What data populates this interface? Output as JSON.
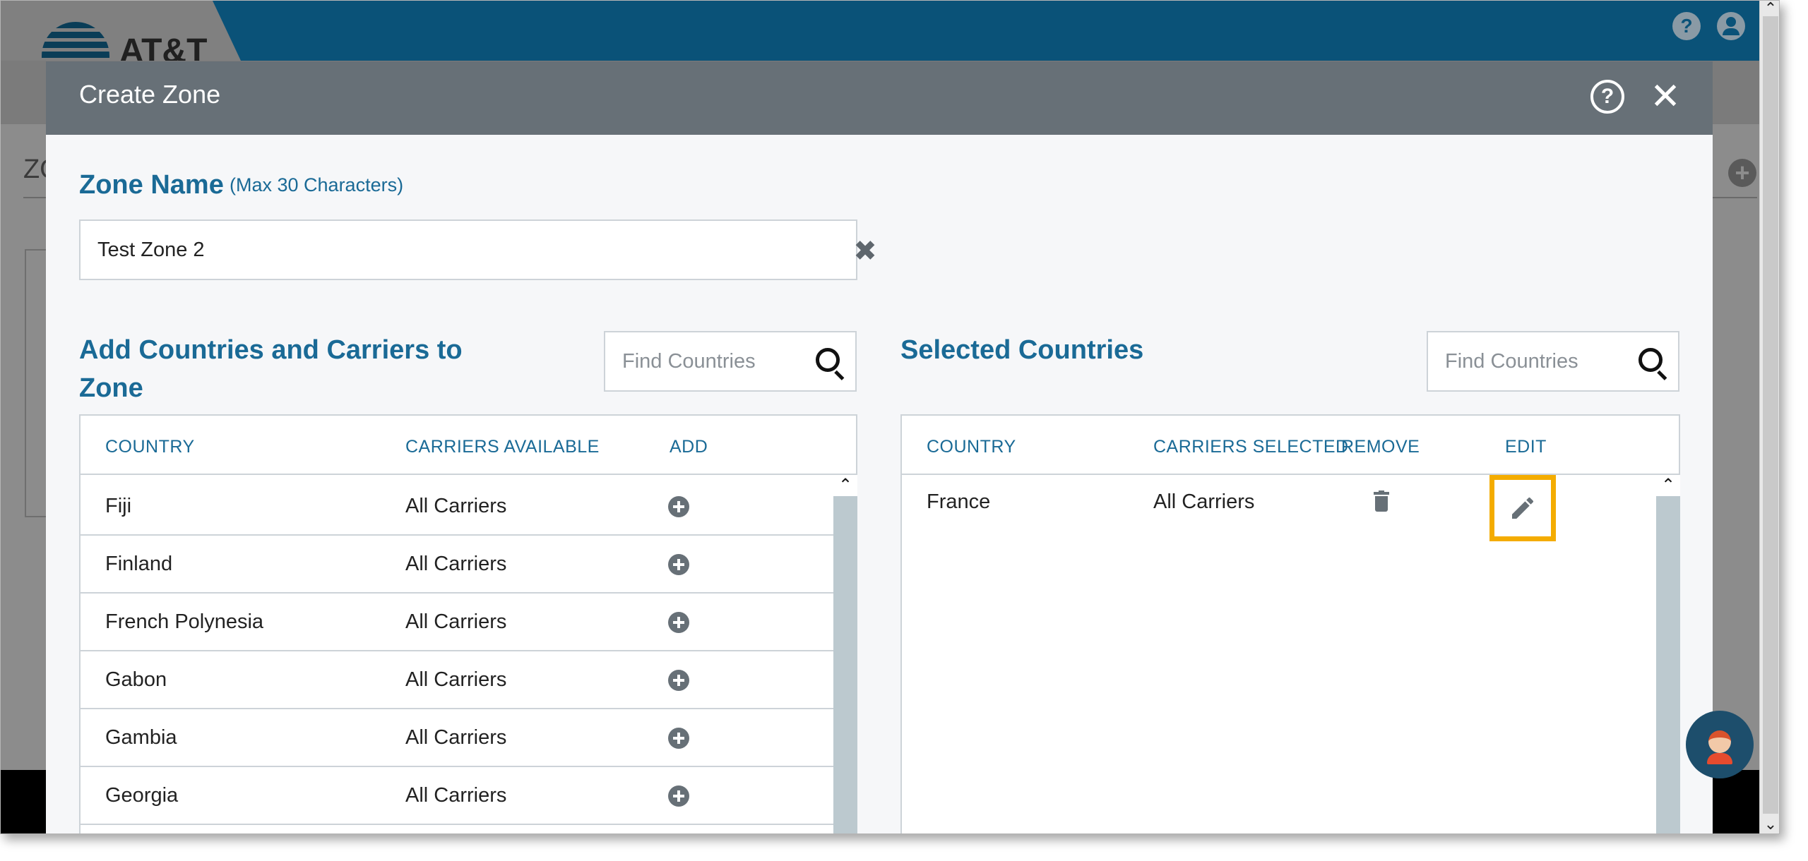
{
  "app": {
    "brand": "AT&T",
    "background_heading": "ZO"
  },
  "modal": {
    "title": "Create Zone",
    "zone_name_label": "Zone Name",
    "zone_name_hint": "(Max 30 Characters)",
    "zone_name_value": "Test Zone 2"
  },
  "left_panel": {
    "title": "Add Countries and Carriers to Zone",
    "search_placeholder": "Find Countries",
    "columns": [
      "COUNTRY",
      "CARRIERS AVAILABLE",
      "ADD"
    ],
    "rows": [
      {
        "country": "Fiji",
        "carriers": "All Carriers"
      },
      {
        "country": "Finland",
        "carriers": "All Carriers"
      },
      {
        "country": "French Polynesia",
        "carriers": "All Carriers"
      },
      {
        "country": "Gabon",
        "carriers": "All Carriers"
      },
      {
        "country": "Gambia",
        "carriers": "All Carriers"
      },
      {
        "country": "Georgia",
        "carriers": "All Carriers"
      }
    ]
  },
  "right_panel": {
    "title": "Selected Countries",
    "search_placeholder": "Find Countries",
    "columns": [
      "COUNTRY",
      "CARRIERS SELECTED",
      "REMOVE",
      "EDIT"
    ],
    "rows": [
      {
        "country": "France",
        "carriers": "All Carriers"
      }
    ]
  },
  "colors": {
    "header_blue": "#0a5278",
    "modal_header": "#677077",
    "accent_blue": "#1a6a96",
    "edit_highlight": "#f4ac00"
  },
  "icons": [
    "help-icon",
    "user-icon",
    "close-icon",
    "clear-icon",
    "search-icon",
    "add-circle-icon",
    "trash-icon",
    "pencil-icon",
    "chat-avatar-icon"
  ]
}
